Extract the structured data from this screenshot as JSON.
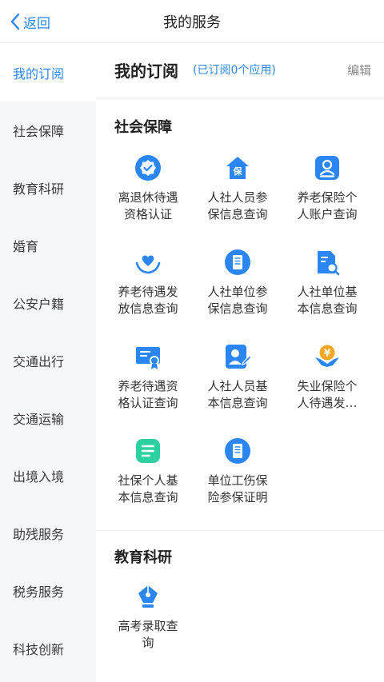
{
  "nav": {
    "back_label": "返回",
    "title": "我的服务"
  },
  "sidebar": {
    "items": [
      {
        "label": "我的订阅"
      },
      {
        "label": "社会保障"
      },
      {
        "label": "教育科研"
      },
      {
        "label": "婚育"
      },
      {
        "label": "公安户籍"
      },
      {
        "label": "交通出行"
      },
      {
        "label": "交通运输"
      },
      {
        "label": "出境入境"
      },
      {
        "label": "助残服务"
      },
      {
        "label": "税务服务"
      },
      {
        "label": "科技创新"
      }
    ]
  },
  "main": {
    "title": "我的订阅",
    "count_label": "(已订阅0个应用)",
    "edit_label": "编辑",
    "sections": [
      {
        "title": "社会保障",
        "apps": [
          {
            "l1": "离退休待遇",
            "l2": "资格认证",
            "icon": "badge-check-icon"
          },
          {
            "l1": "人社人员参",
            "l2": "保信息查询",
            "icon": "house-insurance-icon"
          },
          {
            "l1": "养老保险个",
            "l2": "人账户查询",
            "icon": "person-card-icon"
          },
          {
            "l1": "养老待遇发",
            "l2": "放信息查询",
            "icon": "hands-heart-icon"
          },
          {
            "l1": "人社单位参",
            "l2": "保信息查询",
            "icon": "document-circle-icon"
          },
          {
            "l1": "人社单位基",
            "l2": "本信息查询",
            "icon": "document-search-icon"
          },
          {
            "l1": "养老待遇资",
            "l2": "格认证查询",
            "icon": "certificate-icon"
          },
          {
            "l1": "人社人员基",
            "l2": "本信息查询",
            "icon": "person-edit-icon"
          },
          {
            "l1": "失业保险个",
            "l2": "人待遇发…",
            "icon": "yuan-hands-icon"
          },
          {
            "l1": "社保个人基",
            "l2": "本信息查询",
            "icon": "list-card-icon"
          },
          {
            "l1": "单位工伤保",
            "l2": "险参保证明",
            "icon": "document-circle-icon"
          }
        ]
      },
      {
        "title": "教育科研",
        "apps": [
          {
            "l1": "高考录取查",
            "l2": "询",
            "icon": "pen-nib-icon"
          }
        ]
      }
    ]
  },
  "colors": {
    "accent": "#2b86f3",
    "icon_orange": "#f5a623",
    "sidebar_bg": "#f6f7f9",
    "icon_green": "#2ecfa0"
  }
}
